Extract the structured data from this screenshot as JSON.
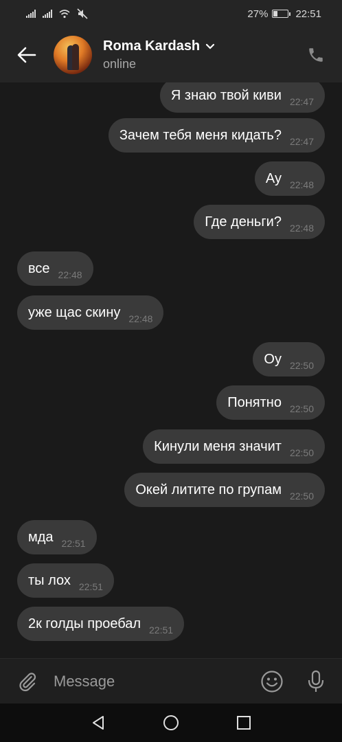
{
  "status_bar": {
    "battery": "27%",
    "battery_level": 0.27,
    "time": "22:51"
  },
  "header": {
    "contact_name": "Roma Kardash",
    "contact_status": "online"
  },
  "messages": [
    {
      "text": "Я знаю твой киви",
      "time": "22:47",
      "side": "out"
    },
    {
      "text": "Зачем тебя меня кидать?",
      "time": "22:47",
      "side": "out"
    },
    {
      "text": "Ау",
      "time": "22:48",
      "side": "out"
    },
    {
      "text": "Где деньги?",
      "time": "22:48",
      "side": "out"
    },
    {
      "text": "все",
      "time": "22:48",
      "side": "in"
    },
    {
      "text": "уже щас скину",
      "time": "22:48",
      "side": "in"
    },
    {
      "text": "Оу",
      "time": "22:50",
      "side": "out"
    },
    {
      "text": "Понятно",
      "time": "22:50",
      "side": "out"
    },
    {
      "text": "Кинули меня значит",
      "time": "22:50",
      "side": "out"
    },
    {
      "text": "Окей литите по групам",
      "time": "22:50",
      "side": "out"
    },
    {
      "text": "мда",
      "time": "22:51",
      "side": "in"
    },
    {
      "text": "ты лох",
      "time": "22:51",
      "side": "in"
    },
    {
      "text": "2к голды проебал",
      "time": "22:51",
      "side": "in"
    }
  ],
  "input": {
    "placeholder": "Message",
    "value": ""
  },
  "icons": {
    "back": "arrow-left-icon",
    "call": "phone-icon",
    "attach": "paperclip-icon",
    "emoji": "smiley-icon",
    "mic": "microphone-icon",
    "nav_back": "triangle-back-icon",
    "nav_home": "circle-home-icon",
    "nav_recents": "square-recents-icon"
  },
  "colors": {
    "background": "#1a1a1a",
    "header": "#252525",
    "bubble": "#3a3a3a",
    "time_text": "#7b7b7b"
  }
}
